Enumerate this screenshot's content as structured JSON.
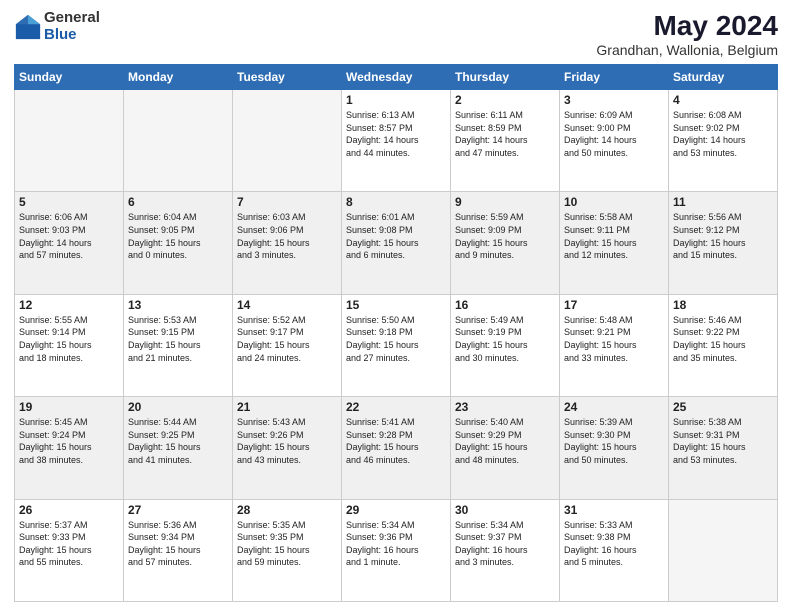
{
  "logo": {
    "general": "General",
    "blue": "Blue"
  },
  "title": "May 2024",
  "location": "Grandhan, Wallonia, Belgium",
  "days_header": [
    "Sunday",
    "Monday",
    "Tuesday",
    "Wednesday",
    "Thursday",
    "Friday",
    "Saturday"
  ],
  "weeks": [
    [
      {
        "day": "",
        "info": ""
      },
      {
        "day": "",
        "info": ""
      },
      {
        "day": "",
        "info": ""
      },
      {
        "day": "1",
        "info": "Sunrise: 6:13 AM\nSunset: 8:57 PM\nDaylight: 14 hours\nand 44 minutes."
      },
      {
        "day": "2",
        "info": "Sunrise: 6:11 AM\nSunset: 8:59 PM\nDaylight: 14 hours\nand 47 minutes."
      },
      {
        "day": "3",
        "info": "Sunrise: 6:09 AM\nSunset: 9:00 PM\nDaylight: 14 hours\nand 50 minutes."
      },
      {
        "day": "4",
        "info": "Sunrise: 6:08 AM\nSunset: 9:02 PM\nDaylight: 14 hours\nand 53 minutes."
      }
    ],
    [
      {
        "day": "5",
        "info": "Sunrise: 6:06 AM\nSunset: 9:03 PM\nDaylight: 14 hours\nand 57 minutes."
      },
      {
        "day": "6",
        "info": "Sunrise: 6:04 AM\nSunset: 9:05 PM\nDaylight: 15 hours\nand 0 minutes."
      },
      {
        "day": "7",
        "info": "Sunrise: 6:03 AM\nSunset: 9:06 PM\nDaylight: 15 hours\nand 3 minutes."
      },
      {
        "day": "8",
        "info": "Sunrise: 6:01 AM\nSunset: 9:08 PM\nDaylight: 15 hours\nand 6 minutes."
      },
      {
        "day": "9",
        "info": "Sunrise: 5:59 AM\nSunset: 9:09 PM\nDaylight: 15 hours\nand 9 minutes."
      },
      {
        "day": "10",
        "info": "Sunrise: 5:58 AM\nSunset: 9:11 PM\nDaylight: 15 hours\nand 12 minutes."
      },
      {
        "day": "11",
        "info": "Sunrise: 5:56 AM\nSunset: 9:12 PM\nDaylight: 15 hours\nand 15 minutes."
      }
    ],
    [
      {
        "day": "12",
        "info": "Sunrise: 5:55 AM\nSunset: 9:14 PM\nDaylight: 15 hours\nand 18 minutes."
      },
      {
        "day": "13",
        "info": "Sunrise: 5:53 AM\nSunset: 9:15 PM\nDaylight: 15 hours\nand 21 minutes."
      },
      {
        "day": "14",
        "info": "Sunrise: 5:52 AM\nSunset: 9:17 PM\nDaylight: 15 hours\nand 24 minutes."
      },
      {
        "day": "15",
        "info": "Sunrise: 5:50 AM\nSunset: 9:18 PM\nDaylight: 15 hours\nand 27 minutes."
      },
      {
        "day": "16",
        "info": "Sunrise: 5:49 AM\nSunset: 9:19 PM\nDaylight: 15 hours\nand 30 minutes."
      },
      {
        "day": "17",
        "info": "Sunrise: 5:48 AM\nSunset: 9:21 PM\nDaylight: 15 hours\nand 33 minutes."
      },
      {
        "day": "18",
        "info": "Sunrise: 5:46 AM\nSunset: 9:22 PM\nDaylight: 15 hours\nand 35 minutes."
      }
    ],
    [
      {
        "day": "19",
        "info": "Sunrise: 5:45 AM\nSunset: 9:24 PM\nDaylight: 15 hours\nand 38 minutes."
      },
      {
        "day": "20",
        "info": "Sunrise: 5:44 AM\nSunset: 9:25 PM\nDaylight: 15 hours\nand 41 minutes."
      },
      {
        "day": "21",
        "info": "Sunrise: 5:43 AM\nSunset: 9:26 PM\nDaylight: 15 hours\nand 43 minutes."
      },
      {
        "day": "22",
        "info": "Sunrise: 5:41 AM\nSunset: 9:28 PM\nDaylight: 15 hours\nand 46 minutes."
      },
      {
        "day": "23",
        "info": "Sunrise: 5:40 AM\nSunset: 9:29 PM\nDaylight: 15 hours\nand 48 minutes."
      },
      {
        "day": "24",
        "info": "Sunrise: 5:39 AM\nSunset: 9:30 PM\nDaylight: 15 hours\nand 50 minutes."
      },
      {
        "day": "25",
        "info": "Sunrise: 5:38 AM\nSunset: 9:31 PM\nDaylight: 15 hours\nand 53 minutes."
      }
    ],
    [
      {
        "day": "26",
        "info": "Sunrise: 5:37 AM\nSunset: 9:33 PM\nDaylight: 15 hours\nand 55 minutes."
      },
      {
        "day": "27",
        "info": "Sunrise: 5:36 AM\nSunset: 9:34 PM\nDaylight: 15 hours\nand 57 minutes."
      },
      {
        "day": "28",
        "info": "Sunrise: 5:35 AM\nSunset: 9:35 PM\nDaylight: 15 hours\nand 59 minutes."
      },
      {
        "day": "29",
        "info": "Sunrise: 5:34 AM\nSunset: 9:36 PM\nDaylight: 16 hours\nand 1 minute."
      },
      {
        "day": "30",
        "info": "Sunrise: 5:34 AM\nSunset: 9:37 PM\nDaylight: 16 hours\nand 3 minutes."
      },
      {
        "day": "31",
        "info": "Sunrise: 5:33 AM\nSunset: 9:38 PM\nDaylight: 16 hours\nand 5 minutes."
      },
      {
        "day": "",
        "info": ""
      }
    ]
  ]
}
